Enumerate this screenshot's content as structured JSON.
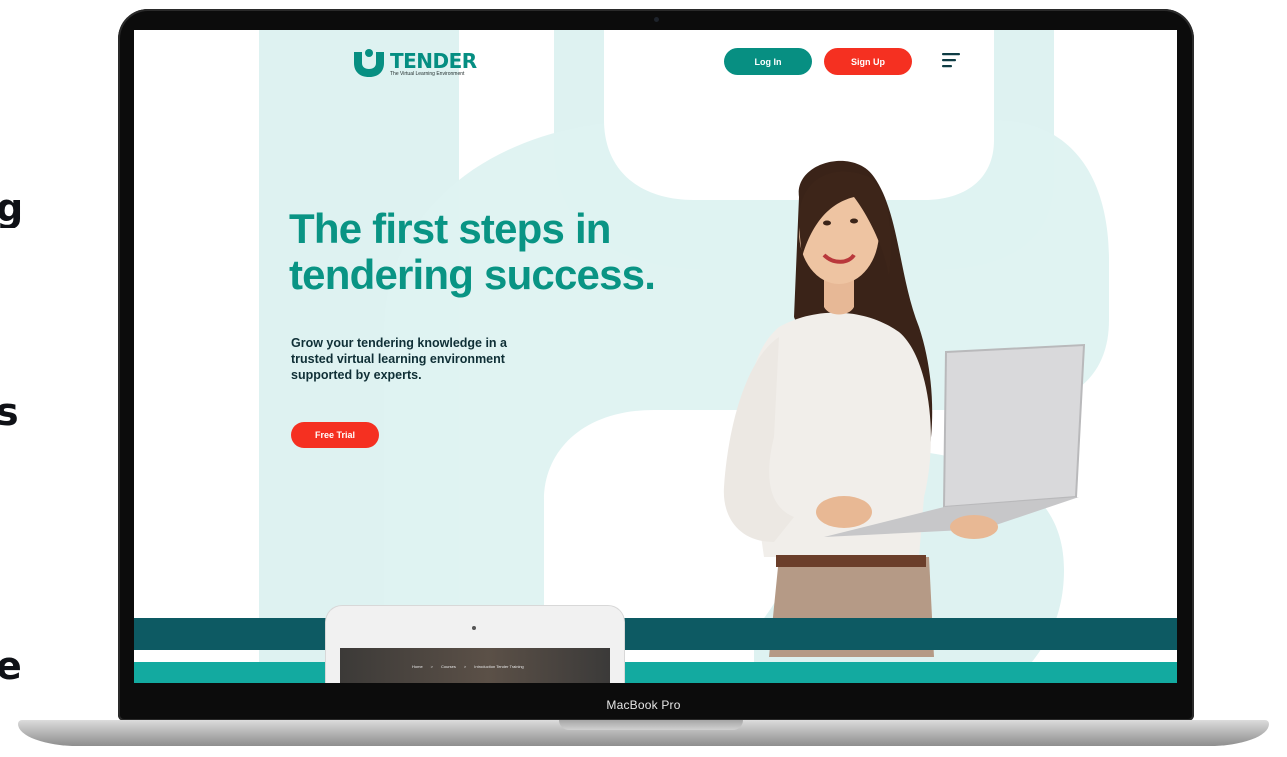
{
  "left_edge_letters": [
    "g",
    "s",
    "e"
  ],
  "laptop": {
    "model_label": "MacBook Pro"
  },
  "site": {
    "logo": {
      "word": "TENDER",
      "tagline": "The Virtual Learning Environment"
    },
    "header": {
      "login_label": "Log In",
      "signup_label": "Sign Up",
      "menu_icon": "hamburger-menu-icon"
    },
    "hero": {
      "title": "The first steps in tendering success.",
      "subtitle": "Grow your tendering knowledge in a trusted virtual learning environment supported by experts.",
      "cta_label": "Free Trial"
    },
    "breadcrumb": [
      "Home",
      ">",
      "Courses",
      ">",
      "Introduction Tender Training"
    ]
  },
  "colors": {
    "brand_teal": "#078f82",
    "accent_red": "#f53021",
    "mint_bg": "#def2f1",
    "band_dark": "#0d5a63",
    "band_teal": "#13aaa0"
  }
}
